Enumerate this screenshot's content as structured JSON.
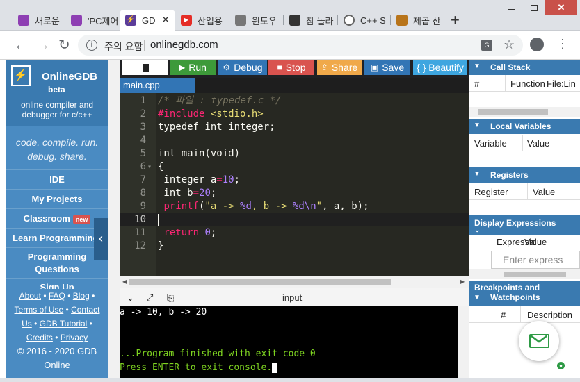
{
  "browser": {
    "tabs": [
      {
        "label": "새로운",
        "favicon_color": "#8e3fb3"
      },
      {
        "label": "'PC제어",
        "favicon_color": "#8e3fb3"
      },
      {
        "label": "GD",
        "favicon_color": "#5b3c99"
      },
      {
        "label": "산업용",
        "favicon_color": "#e52d27"
      },
      {
        "label": "윈도우",
        "favicon_color": "#777777"
      },
      {
        "label": "참 놀라",
        "favicon_color": "#333333"
      },
      {
        "label": "C++ S",
        "favicon_color": "#666666"
      },
      {
        "label": "제곱 산",
        "favicon_color": "#b8741a"
      }
    ],
    "new_tab": "+",
    "security_warning": "주의 요함",
    "url": "onlinegdb.com",
    "info_glyph": "i"
  },
  "sidebar": {
    "brand": "OnlineGDB",
    "beta": "beta",
    "tagline_line1": "online compiler and",
    "tagline_line2": "debugger for c/c++",
    "motto_line1": "code. compile. run.",
    "motto_line2": "debug. share.",
    "menu": {
      "ide": "IDE",
      "my_projects": "My Projects",
      "classroom": "Classroom",
      "new_badge": "new",
      "learn": "Learn Programming",
      "programming_questions": "Programming Questions",
      "sign_up": "Sign Up"
    },
    "footer": {
      "about": "About",
      "faq": "FAQ",
      "blog": "Blog",
      "terms": "Terms of Use",
      "contact": "Contact",
      "us": "Us",
      "gdb_tutorial": "GDB Tutorial",
      "credits": "Credits",
      "privacy": "Privacy",
      "copyright_line1": "© 2016 - 2020 GDB",
      "copyright_line2": "Online"
    },
    "collapse_glyph": "‹"
  },
  "toolbar": {
    "run": "Run",
    "debug": "Debug",
    "stop": "Stop",
    "share": "Share",
    "save": "Save",
    "beautify": "{ } Beautify",
    "colors": {
      "run": "#3d9a3a",
      "debug": "#3275b5",
      "stop": "#d9534f",
      "share": "#f0a94a",
      "save": "#3275b5",
      "beautify": "#3ea6e0"
    }
  },
  "editor": {
    "file_tab": "main.cpp",
    "line_numbers": [
      "1",
      "2",
      "3",
      "4",
      "5",
      "6",
      "7",
      "8",
      "9",
      "10",
      "11",
      "12"
    ],
    "fold_marker": "▾"
  },
  "console": {
    "header": "input",
    "output_line1": "a -> 10, b -> 20",
    "output_line2": "...Program finished with exit code 0",
    "output_line3": "Press ENTER to exit console."
  },
  "right_panel": {
    "call_stack": {
      "title": "Call Stack",
      "col1": "#",
      "col2": "Function",
      "col3": "File:Lin"
    },
    "local_vars": {
      "title": "Local Variables",
      "col1": "Variable",
      "col2": "Value"
    },
    "registers": {
      "title": "Registers",
      "col1": "Register",
      "col2": "Value"
    },
    "display_expr": {
      "title": "Display Expressions",
      "col1": "Expressio",
      "col2": "Value",
      "placeholder": "Enter express"
    },
    "breakpoints": {
      "title_line1": "Breakpoints and",
      "title_line2": "Watchpoints",
      "col1": "#",
      "col2": "Description"
    }
  }
}
